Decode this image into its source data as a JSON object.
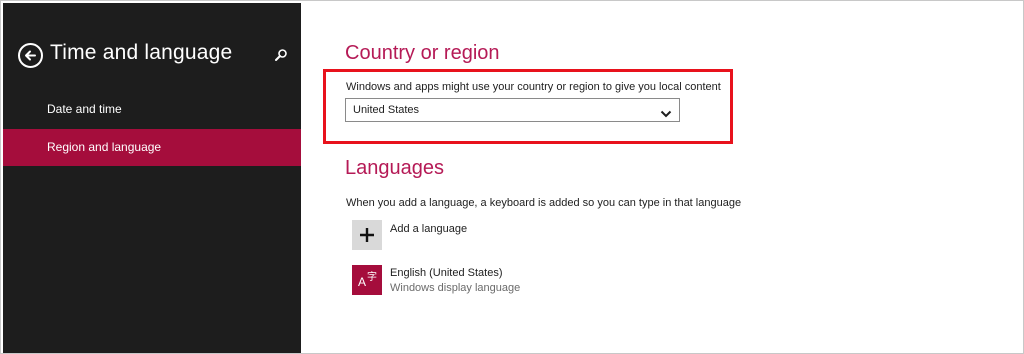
{
  "sidebar": {
    "title": "Time and language",
    "items": [
      {
        "label": "Date and time",
        "selected": false
      },
      {
        "label": "Region and language",
        "selected": true
      }
    ]
  },
  "icons": {
    "back": "back-arrow-circle-icon",
    "search": "search-icon",
    "chevron": "chevron-down-icon",
    "add": "plus-icon",
    "language": "language-icon"
  },
  "country": {
    "heading": "Country or region",
    "description": "Windows and apps might use your country or region to give you local content",
    "selected": "United States"
  },
  "languages": {
    "heading": "Languages",
    "description": "When you add a language, a keyboard is added so you can type in that language",
    "add_label": "Add a language",
    "items": [
      {
        "name": "English (United States)",
        "detail": "Windows display language",
        "glyph_a": "A",
        "glyph_b": "字"
      }
    ]
  },
  "colors": {
    "accent": "#a50d3c",
    "heading": "#b51a56",
    "sidebar_bg": "#1d1d1d",
    "highlight": "#e8121c"
  }
}
